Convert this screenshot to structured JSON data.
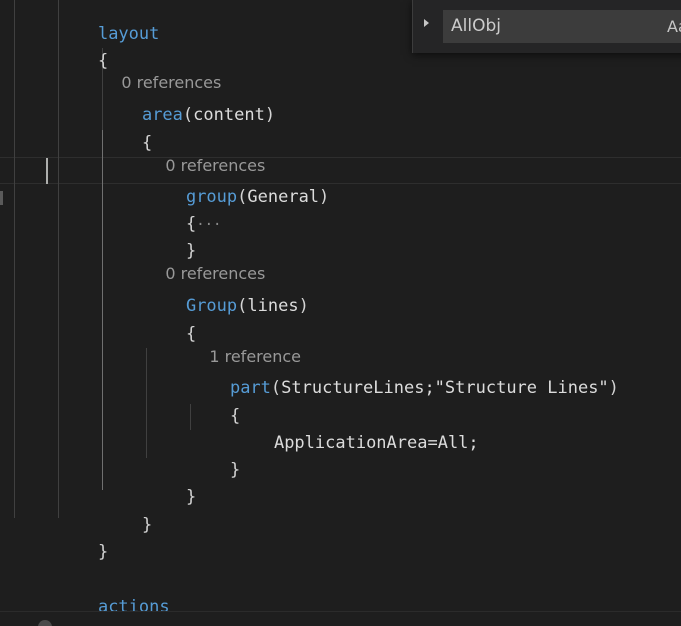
{
  "editor": {
    "lines": {
      "layout_kw": "layout",
      "open_brace": "{",
      "lens_area": "0 references",
      "area_kw": "area",
      "area_arg": "content",
      "lens_group_general": "0 references",
      "group_kw": "group",
      "group_general_arg": "General",
      "fold_ellipsis": "···",
      "lens_group_lines": "0 references",
      "group_lines_kw": "Group",
      "group_lines_arg": "lines",
      "lens_part": "1 reference",
      "part_kw": "part",
      "part_args": "StructureLines;\"Structure Lines\"",
      "application_area": "ApplicationArea=All;",
      "actions_kw": "actions"
    }
  },
  "find_widget": {
    "query": "AllObj",
    "match_case_label": "Aa",
    "toggle_icon": "chevron-right-icon"
  },
  "colors": {
    "background": "#1e1e1e",
    "keyword": "#569cd6",
    "text": "#d4d4d4",
    "codelens": "#999999"
  }
}
